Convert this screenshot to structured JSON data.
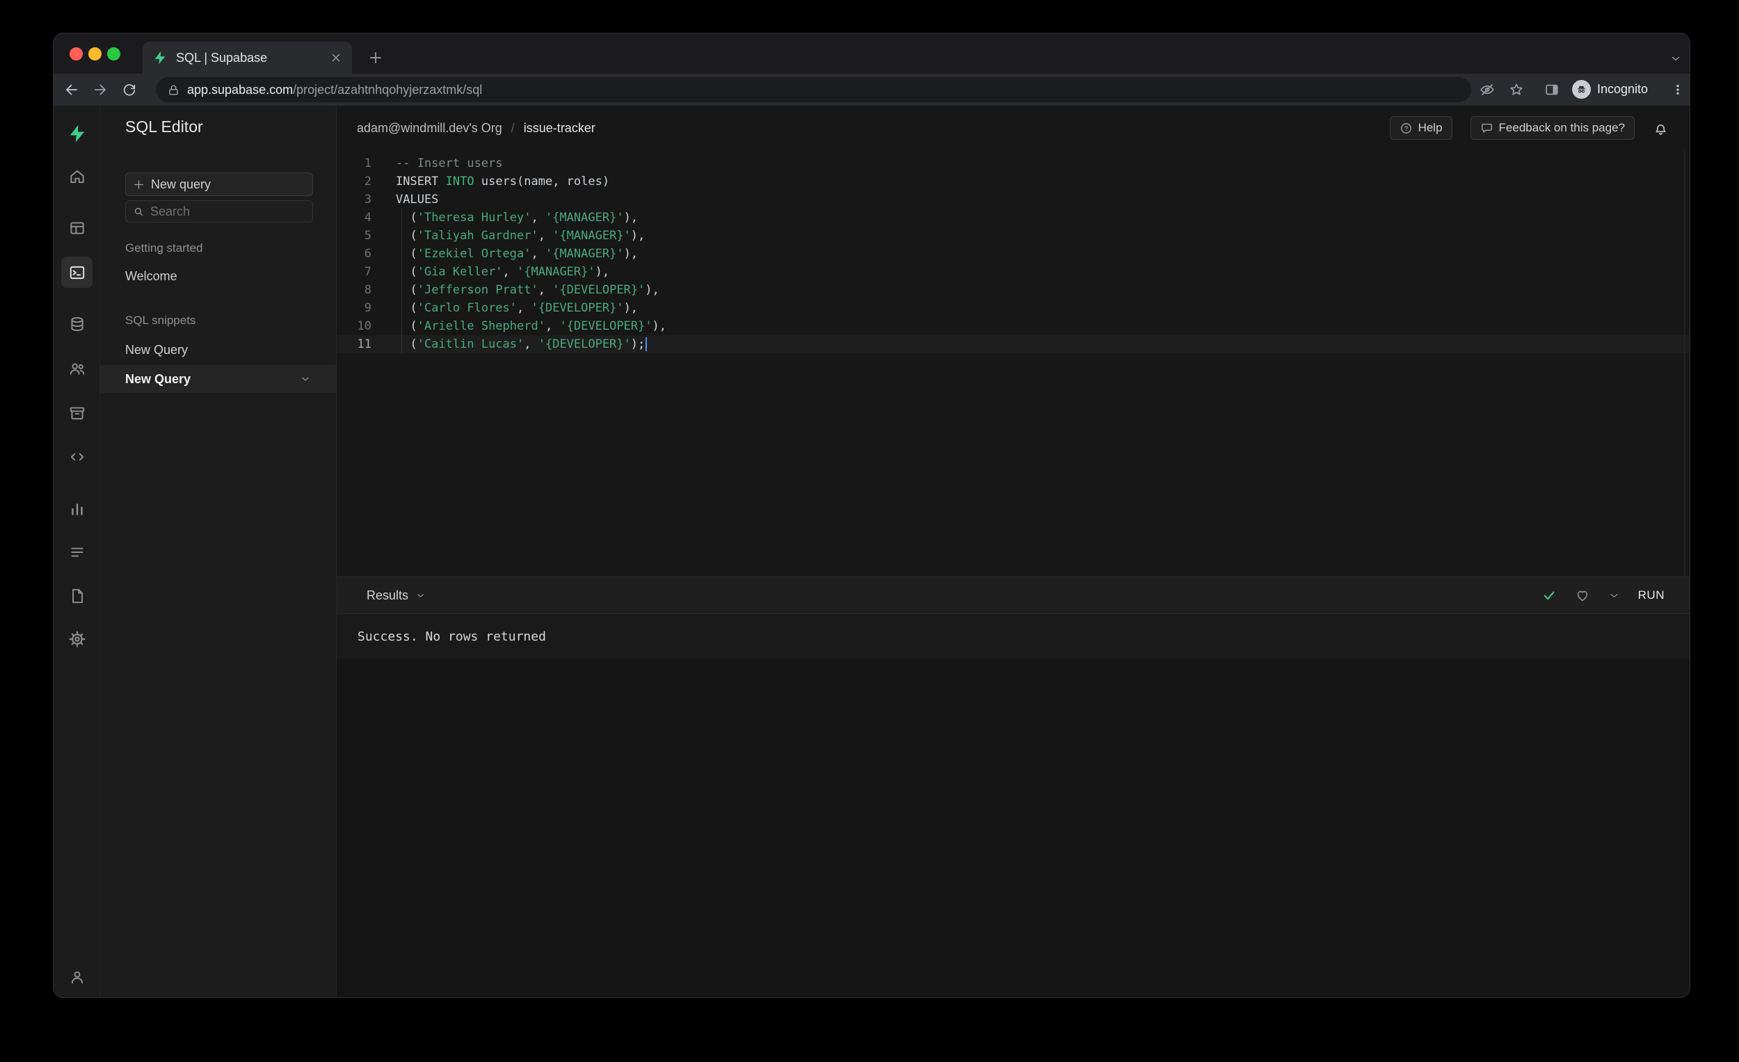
{
  "browser": {
    "tab_title": "SQL | Supabase",
    "url_domain": "app.supabase.com",
    "url_path": "/project/azahtnhqohyjerzaxtmk/sql",
    "incognito_label": "Incognito"
  },
  "icons": {
    "help_glyph": "?"
  },
  "sidebar": {
    "title": "SQL Editor",
    "new_query_button": "New query",
    "search_placeholder": "Search",
    "getting_started_label": "Getting started",
    "welcome_item": "Welcome",
    "sql_snippets_label": "SQL snippets",
    "snippet_item_1": "New Query",
    "snippet_item_2": "New Query"
  },
  "header": {
    "breadcrumb_org": "adam@windmill.dev's Org",
    "breadcrumb_separator": "/",
    "breadcrumb_project": "issue-tracker",
    "help_button": "Help",
    "feedback_button": "Feedback on this page?"
  },
  "editor": {
    "lines": [
      {
        "n": "1",
        "tokens": [
          {
            "t": "-- Insert users",
            "c": "com"
          }
        ]
      },
      {
        "n": "2",
        "tokens": [
          {
            "t": "INSERT",
            "c": "kwl"
          },
          {
            "t": " ",
            "c": "pln"
          },
          {
            "t": "INTO",
            "c": "kw"
          },
          {
            "t": " users(name, roles)",
            "c": "pln"
          }
        ]
      },
      {
        "n": "3",
        "tokens": [
          {
            "t": "VALUES",
            "c": "pln"
          }
        ]
      },
      {
        "n": "4",
        "tokens": [
          {
            "t": "  (",
            "c": "pln"
          },
          {
            "t": "'Theresa Hurley'",
            "c": "str"
          },
          {
            "t": ", ",
            "c": "pln"
          },
          {
            "t": "'{MANAGER}'",
            "c": "str"
          },
          {
            "t": "),",
            "c": "pln"
          }
        ]
      },
      {
        "n": "5",
        "tokens": [
          {
            "t": "  (",
            "c": "pln"
          },
          {
            "t": "'Taliyah Gardner'",
            "c": "str"
          },
          {
            "t": ", ",
            "c": "pln"
          },
          {
            "t": "'{MANAGER}'",
            "c": "str"
          },
          {
            "t": "),",
            "c": "pln"
          }
        ]
      },
      {
        "n": "6",
        "tokens": [
          {
            "t": "  (",
            "c": "pln"
          },
          {
            "t": "'Ezekiel Ortega'",
            "c": "str"
          },
          {
            "t": ", ",
            "c": "pln"
          },
          {
            "t": "'{MANAGER}'",
            "c": "str"
          },
          {
            "t": "),",
            "c": "pln"
          }
        ]
      },
      {
        "n": "7",
        "tokens": [
          {
            "t": "  (",
            "c": "pln"
          },
          {
            "t": "'Gia Keller'",
            "c": "str"
          },
          {
            "t": ", ",
            "c": "pln"
          },
          {
            "t": "'{MANAGER}'",
            "c": "str"
          },
          {
            "t": "),",
            "c": "pln"
          }
        ]
      },
      {
        "n": "8",
        "tokens": [
          {
            "t": "  (",
            "c": "pln"
          },
          {
            "t": "'Jefferson Pratt'",
            "c": "str"
          },
          {
            "t": ", ",
            "c": "pln"
          },
          {
            "t": "'{DEVELOPER}'",
            "c": "str"
          },
          {
            "t": "),",
            "c": "pln"
          }
        ]
      },
      {
        "n": "9",
        "tokens": [
          {
            "t": "  (",
            "c": "pln"
          },
          {
            "t": "'Carlo Flores'",
            "c": "str"
          },
          {
            "t": ", ",
            "c": "pln"
          },
          {
            "t": "'{DEVELOPER}'",
            "c": "str"
          },
          {
            "t": "),",
            "c": "pln"
          }
        ]
      },
      {
        "n": "10",
        "tokens": [
          {
            "t": "  (",
            "c": "pln"
          },
          {
            "t": "'Arielle Shepherd'",
            "c": "str"
          },
          {
            "t": ", ",
            "c": "pln"
          },
          {
            "t": "'{DEVELOPER}'",
            "c": "str"
          },
          {
            "t": "),",
            "c": "pln"
          }
        ]
      },
      {
        "n": "11",
        "active": true,
        "cursor": true,
        "tokens": [
          {
            "t": "  (",
            "c": "pln"
          },
          {
            "t": "'Caitlin Lucas'",
            "c": "str"
          },
          {
            "t": ", ",
            "c": "pln"
          },
          {
            "t": "'{DEVELOPER}'",
            "c": "str"
          },
          {
            "t": ");",
            "c": "pln"
          }
        ]
      }
    ]
  },
  "results": {
    "label": "Results",
    "run_button": "RUN",
    "message": "Success. No rows returned"
  },
  "colors": {
    "accent_green": "#3ecf8e",
    "keyword": "#3cb87e",
    "string": "#4aa87e",
    "comment": "#7d8b8a",
    "cursor": "#528bff"
  }
}
